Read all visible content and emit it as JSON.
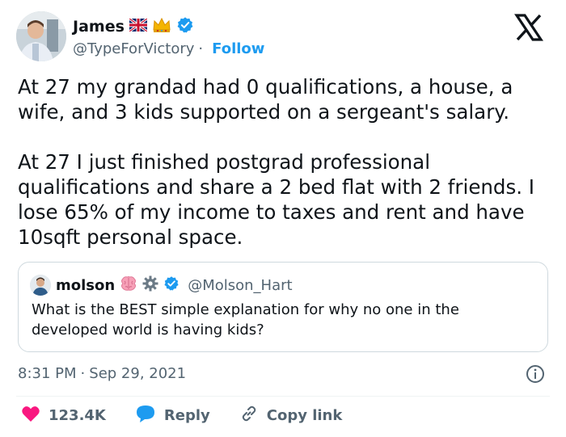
{
  "author": {
    "name": "James",
    "handle": "@TypeForVictory",
    "separator": "·",
    "follow_label": "Follow",
    "badges": [
      "uk-flag-icon",
      "crown-icon",
      "verified-badge-icon"
    ]
  },
  "tweet": {
    "paragraph1": "At 27 my grandad had 0 qualifications, a house, a wife, and 3 kids supported on a sergeant's salary.",
    "paragraph2": "At 27 I just finished postgrad professional qualifications and share a 2 bed flat with 2 friends. I lose 65% of my income to taxes and rent and have 10sqft personal space."
  },
  "quote": {
    "name": "molson",
    "handle": "@Molson_Hart",
    "badges": [
      "brain-icon",
      "gear-icon",
      "verified-badge-icon"
    ],
    "text": "What is the BEST simple explanation for why no one in the developed world is having kids?"
  },
  "meta": {
    "time": "8:31 PM",
    "separator": "·",
    "date": "Sep 29, 2021"
  },
  "actions": {
    "likes": "123.4K",
    "reply_label": "Reply",
    "copy_label": "Copy link"
  },
  "colors": {
    "accent": "#1d9bf0",
    "like": "#f91880",
    "text": "#0f1419",
    "muted": "#536471",
    "border": "#cfd9de"
  }
}
